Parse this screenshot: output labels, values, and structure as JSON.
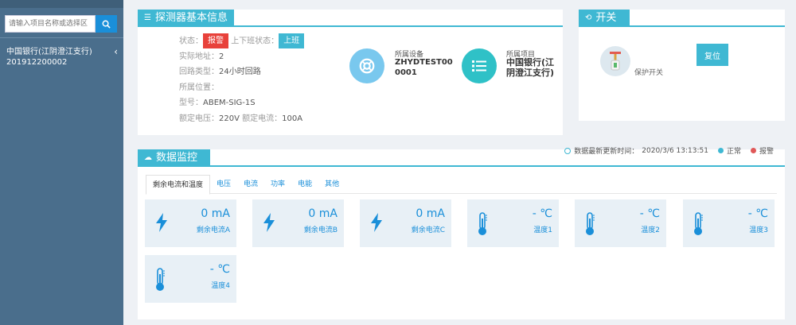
{
  "sidebar": {
    "search_placeholder": "请输入项目名称或选择区",
    "item_name": "中国银行(江阴澄江支行)",
    "item_code": "201912200002"
  },
  "info": {
    "title": "探测器基本信息",
    "status_label": "状态：",
    "status_value": "报警",
    "shift_label": "上下班状态：",
    "shift_value": "上班",
    "address_label": "实际地址：",
    "address_value": "2",
    "loop_label": "回路类型：",
    "loop_value": "24小时回路",
    "location_label": "所属位置：",
    "location_value": "",
    "model_label": "型号：",
    "model_value": "ABEM-SIG-1S",
    "voltage_label": "额定电压：",
    "voltage_value": "220V",
    "current_label": "额定电流：",
    "current_value": "100A",
    "device_label": "所属设备",
    "device_value": "ZHYDTEST00\n0001",
    "project_label": "所属项目",
    "project_value": "中国银行(江\n阴澄江支行)"
  },
  "switch": {
    "title": "开关",
    "label": "保护开关",
    "reset_label": "复位"
  },
  "monitor": {
    "title": "数据监控",
    "update_label": "数据最新更新时间：",
    "update_time": "2020/3/6 13:13:51",
    "normal_label": "正常",
    "alarm_label": "报警",
    "tabs": [
      "剩余电流和温度",
      "电压",
      "电流",
      "功率",
      "电能",
      "其他"
    ],
    "cards": [
      {
        "value": "0 mA",
        "label": "剩余电流A",
        "icon": "lightning-icon"
      },
      {
        "value": "0 mA",
        "label": "剩余电流B",
        "icon": "lightning-icon"
      },
      {
        "value": "0 mA",
        "label": "剩余电流C",
        "icon": "lightning-icon"
      },
      {
        "value": "- ℃",
        "label": "温度1",
        "icon": "thermometer-icon"
      },
      {
        "value": "- ℃",
        "label": "温度2",
        "icon": "thermometer-icon"
      },
      {
        "value": "- ℃",
        "label": "温度3",
        "icon": "thermometer-icon"
      },
      {
        "value": "- ℃",
        "label": "温度4",
        "icon": "thermometer-icon"
      }
    ]
  },
  "colors": {
    "accent": "#3fb8d3",
    "sidebar": "#4a6e8c",
    "alarm": "#e8413a",
    "link": "#1a8fd9"
  }
}
